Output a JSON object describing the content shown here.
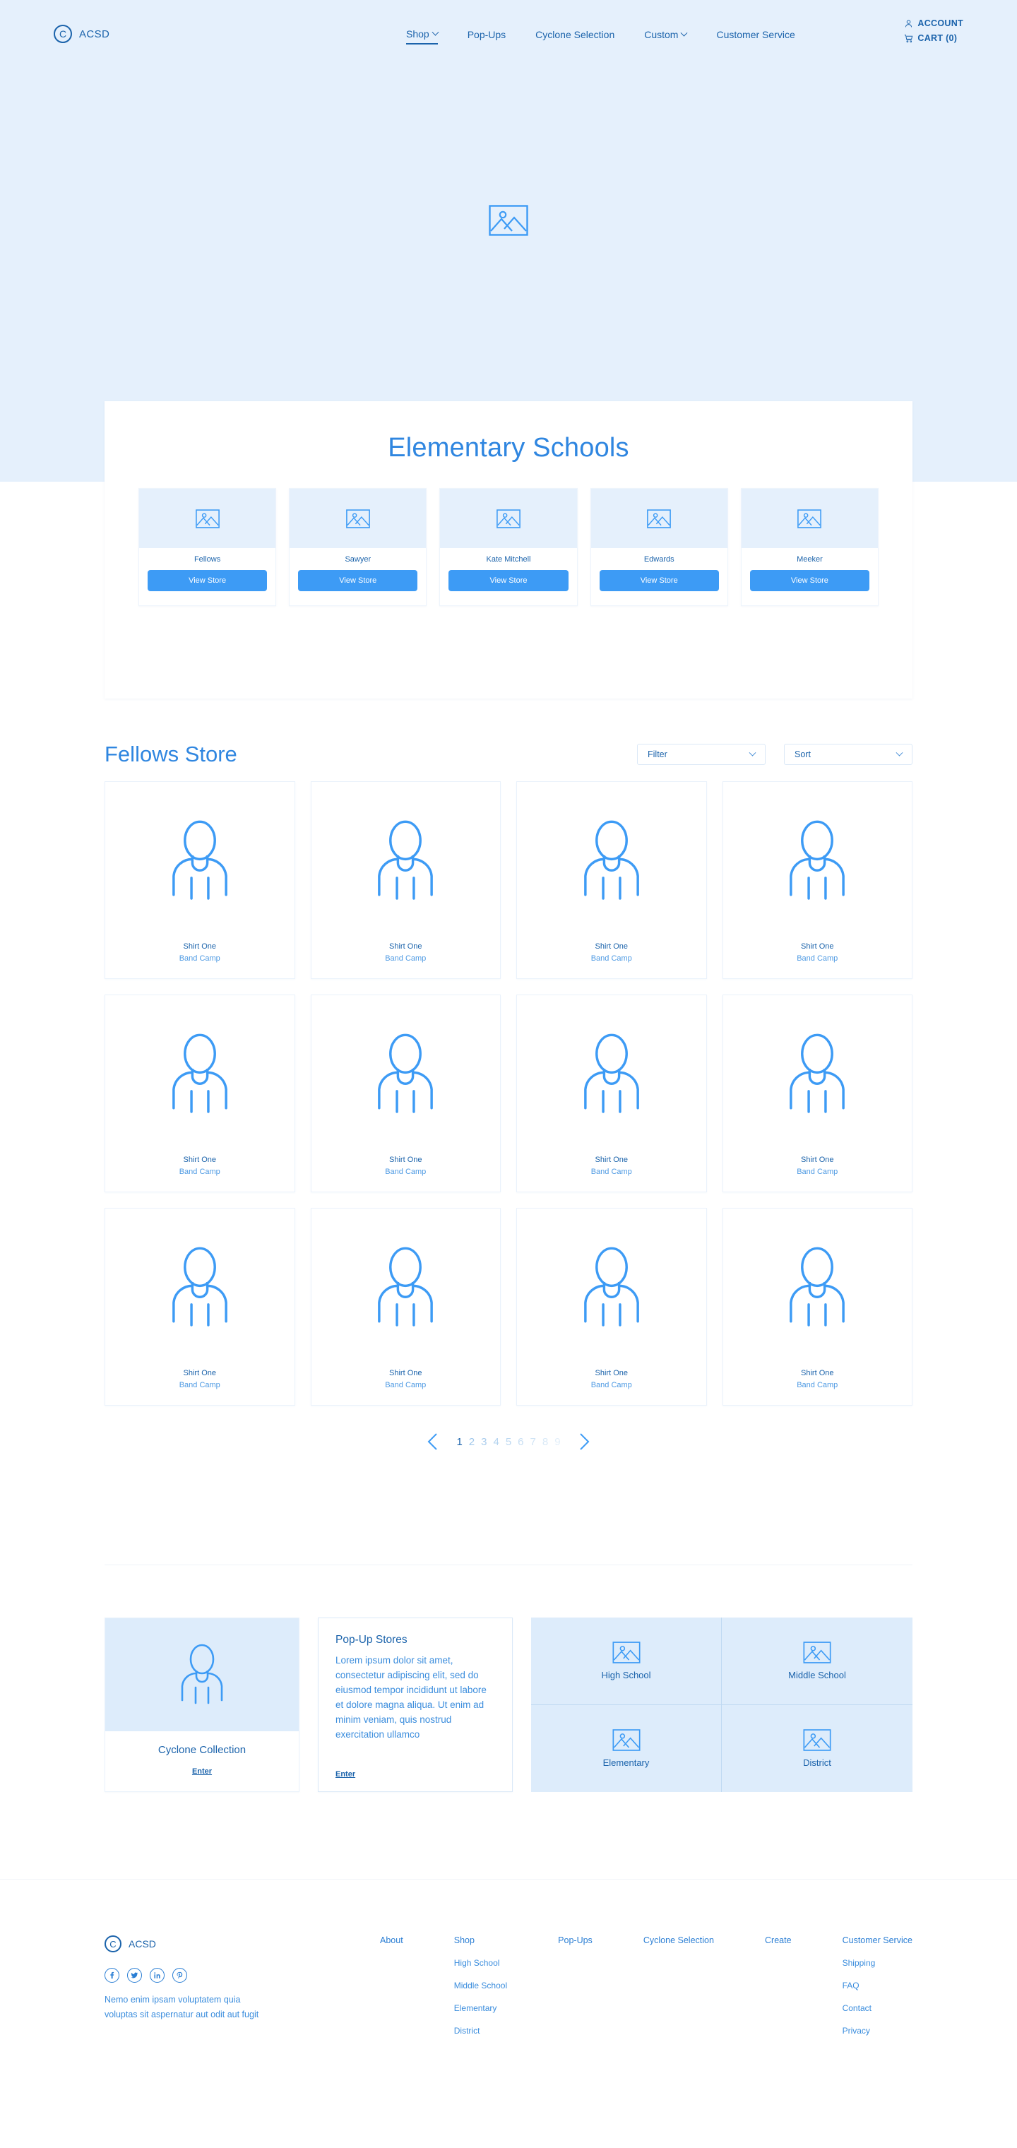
{
  "brand": {
    "mark": "C",
    "name": "ACSD"
  },
  "header": {
    "nav": [
      {
        "label": "Shop",
        "has_caret": true,
        "active": true
      },
      {
        "label": "Pop-Ups",
        "has_caret": false,
        "active": false
      },
      {
        "label": "Cyclone Selection",
        "has_caret": false,
        "active": false
      },
      {
        "label": "Custom",
        "has_caret": true,
        "active": false
      },
      {
        "label": "Customer Service",
        "has_caret": false,
        "active": false
      }
    ],
    "account_label": "ACCOUNT",
    "cart_label": "CART (0)",
    "account_icon": "person-icon",
    "cart_icon": "cart-icon"
  },
  "hero": {
    "placeholder_icon": "image-placeholder-icon"
  },
  "schools": {
    "title": "Elementary Schools",
    "button_label": "View Store",
    "items": [
      {
        "name": "Fellows"
      },
      {
        "name": "Sawyer"
      },
      {
        "name": "Kate Mitchell"
      },
      {
        "name": "Edwards"
      },
      {
        "name": "Meeker"
      }
    ]
  },
  "store": {
    "title": "Fellows Store",
    "filter_label": "Filter",
    "sort_label": "Sort",
    "products": [
      {
        "name": "Shirt One",
        "sub": "Band Camp"
      },
      {
        "name": "Shirt One",
        "sub": "Band Camp"
      },
      {
        "name": "Shirt One",
        "sub": "Band Camp"
      },
      {
        "name": "Shirt One",
        "sub": "Band Camp"
      },
      {
        "name": "Shirt One",
        "sub": "Band Camp"
      },
      {
        "name": "Shirt One",
        "sub": "Band Camp"
      },
      {
        "name": "Shirt One",
        "sub": "Band Camp"
      },
      {
        "name": "Shirt One",
        "sub": "Band Camp"
      },
      {
        "name": "Shirt One",
        "sub": "Band Camp"
      },
      {
        "name": "Shirt One",
        "sub": "Band Camp"
      },
      {
        "name": "Shirt One",
        "sub": "Band Camp"
      },
      {
        "name": "Shirt One",
        "sub": "Band Camp"
      }
    ]
  },
  "pagination": {
    "prev_icon": "chevron-left-icon",
    "next_icon": "chevron-right-icon",
    "pages": [
      "1",
      "2",
      "3",
      "4",
      "5",
      "6",
      "7",
      "8",
      "9"
    ],
    "current": "1"
  },
  "bottom": {
    "collection": {
      "title": "Cyclone Collection",
      "enter_label": "Enter",
      "icon": "shirt-person-icon"
    },
    "popup": {
      "title": "Pop-Up Stores",
      "body": "Lorem ipsum dolor sit amet, consectetur adipiscing elit, sed do eiusmod tempor incididunt ut labore et dolore magna aliqua. Ut enim ad minim veniam, quis nostrud exercitation ullamco",
      "enter_label": "Enter"
    },
    "quadrants": [
      {
        "label": "High School"
      },
      {
        "label": "Middle School"
      },
      {
        "label": "Elementary"
      },
      {
        "label": "District"
      }
    ]
  },
  "footer": {
    "tagline": "Nemo enim ipsam voluptatem quia voluptas sit aspernatur aut odit aut fugit",
    "socials": [
      {
        "name": "facebook-icon",
        "glyph": "f"
      },
      {
        "name": "twitter-icon",
        "glyph": "t"
      },
      {
        "name": "linkedin-icon",
        "glyph": "in"
      },
      {
        "name": "pinterest-icon",
        "glyph": "p"
      }
    ],
    "columns": [
      {
        "head": "About",
        "links": []
      },
      {
        "head": "Shop",
        "links": [
          "High School",
          "Middle School",
          "Elementary",
          "District"
        ]
      },
      {
        "head": "Pop-Ups",
        "links": []
      },
      {
        "head": "Cyclone Selection",
        "links": []
      },
      {
        "head": "Create",
        "links": []
      },
      {
        "head": "Customer Service",
        "links": [
          "Shipping",
          "FAQ",
          "Contact",
          "Privacy"
        ]
      }
    ]
  },
  "colors": {
    "hero_band": "#e5f0fc",
    "accent_blue": "#3d9bf5",
    "title_blue": "#2f86e0",
    "text_blue": "#1b63ab",
    "tint": "#ddecfb"
  }
}
